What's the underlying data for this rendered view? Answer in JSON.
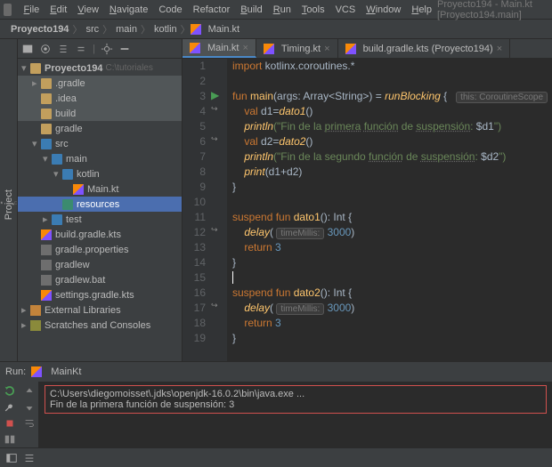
{
  "window_title": "Proyecto194 - Main.kt [Proyecto194.main]",
  "menu": [
    "File",
    "Edit",
    "View",
    "Navigate",
    "Code",
    "Refactor",
    "Build",
    "Run",
    "Tools",
    "VCS",
    "Window",
    "Help"
  ],
  "menu_mnemonic": [
    "F",
    "E",
    "V",
    "N",
    "",
    "",
    "B",
    "R",
    "T",
    "",
    "W",
    "H"
  ],
  "breadcrumb": [
    "Proyecto194",
    "src",
    "main",
    "kotlin",
    "Main.kt"
  ],
  "sidebar_rail": "Project",
  "tree": {
    "root": {
      "label": "Proyecto194",
      "path": "C:\\tutoriales"
    },
    "items": [
      {
        "indent": 1,
        "arrow": ">",
        "icon": "folder",
        "label": ".gradle",
        "dim": true
      },
      {
        "indent": 1,
        "arrow": "",
        "icon": "folder",
        "label": ".idea",
        "dim": true
      },
      {
        "indent": 1,
        "arrow": "",
        "icon": "folder",
        "label": "build",
        "dim": true
      },
      {
        "indent": 1,
        "arrow": "",
        "icon": "folder",
        "label": "gradle"
      },
      {
        "indent": 1,
        "arrow": "v",
        "icon": "folder-blue",
        "label": "src"
      },
      {
        "indent": 2,
        "arrow": "v",
        "icon": "folder-blue",
        "label": "main"
      },
      {
        "indent": 3,
        "arrow": "v",
        "icon": "folder-blue",
        "label": "kotlin"
      },
      {
        "indent": 4,
        "arrow": "",
        "icon": "kt",
        "label": "Main.kt"
      },
      {
        "indent": 3,
        "arrow": "",
        "icon": "folder-res",
        "label": "resources",
        "selected": true
      },
      {
        "indent": 2,
        "arrow": ">",
        "icon": "folder-blue",
        "label": "test"
      },
      {
        "indent": 1,
        "arrow": "",
        "icon": "kts",
        "label": "build.gradle.kts"
      },
      {
        "indent": 1,
        "arrow": "",
        "icon": "file",
        "label": "gradle.properties"
      },
      {
        "indent": 1,
        "arrow": "",
        "icon": "file",
        "label": "gradlew"
      },
      {
        "indent": 1,
        "arrow": "",
        "icon": "file",
        "label": "gradlew.bat"
      },
      {
        "indent": 1,
        "arrow": "",
        "icon": "kts",
        "label": "settings.gradle.kts"
      }
    ],
    "ext_lib": "External Libraries",
    "scratches": "Scratches and Consoles"
  },
  "tabs": [
    {
      "label": "Main.kt",
      "active": true
    },
    {
      "label": "Timing.kt",
      "active": false
    },
    {
      "label": "build.gradle.kts (Proyecto194)",
      "active": false
    }
  ],
  "code": {
    "line1_import": "import",
    "line1_pkg": " kotlinx.coroutines.*",
    "line3_fun": "fun",
    "line3_main": "main",
    "line3_args": "args",
    "line3_type": ": Array<String>) = ",
    "line3_rb": "runBlocking",
    "line3_brace": " {",
    "line3_hint": "this: CoroutineScope",
    "line4_val": "val",
    "line4_d1": " d1=",
    "line4_dato1": "dato1",
    "line4_paren": "()",
    "line5_println": "println",
    "line5_str_a": "(\"Fin de la ",
    "line5_primera": "primera",
    "line5_sp": " ",
    "line5_funcion": "función",
    "line5_de": " de ",
    "line5_susp": "suspensión",
    "line5_col": ": ",
    "line5_dv": "$d1",
    "line5_end": "\")",
    "line6_val": "val",
    "line6_d2": " d2=",
    "line6_dato2": "dato2",
    "line6_paren": "()",
    "line7_println": "println",
    "line7_str_a": "(\"Fin de la segundo ",
    "line7_funcion": "función",
    "line7_de": " de ",
    "line7_susp": "suspensión",
    "line7_col": ": ",
    "line7_dv": "$d2",
    "line7_end": "\")",
    "line8_print": "print",
    "line8_arg": "(d1+d2)",
    "line9": "}",
    "line11_susp": "suspend fun",
    "line11_fn": " dato1",
    "line11_sig": "(): Int {",
    "line12_delay": "delay",
    "line12_hint": "timeMillis:",
    "line12_num": " 3000",
    "line12_close": ")",
    "line12_open": "( ",
    "line13_ret": "return",
    "line13_val": " 3",
    "line14": "}",
    "line16_susp": "suspend fun",
    "line16_fn": " dato2",
    "line16_sig": "(): Int {",
    "line17_delay": "delay",
    "line17_hint": "timeMillis:",
    "line17_num": " 3000",
    "line17_close": ")",
    "line17_open": "( ",
    "line18_ret": "return",
    "line18_val": " 3",
    "line19": "}"
  },
  "line_numbers": [
    "1",
    "2",
    "3",
    "4",
    "5",
    "6",
    "7",
    "8",
    "9",
    "10",
    "11",
    "12",
    "13",
    "14",
    "15",
    "16",
    "17",
    "18",
    "19"
  ],
  "run": {
    "label": "Run:",
    "config": "MainKt",
    "out1": "C:\\Users\\diegomoisset\\.jdks\\openjdk-16.0.2\\bin\\java.exe ...",
    "out2": "Fin de la primera función de suspensión: 3"
  }
}
